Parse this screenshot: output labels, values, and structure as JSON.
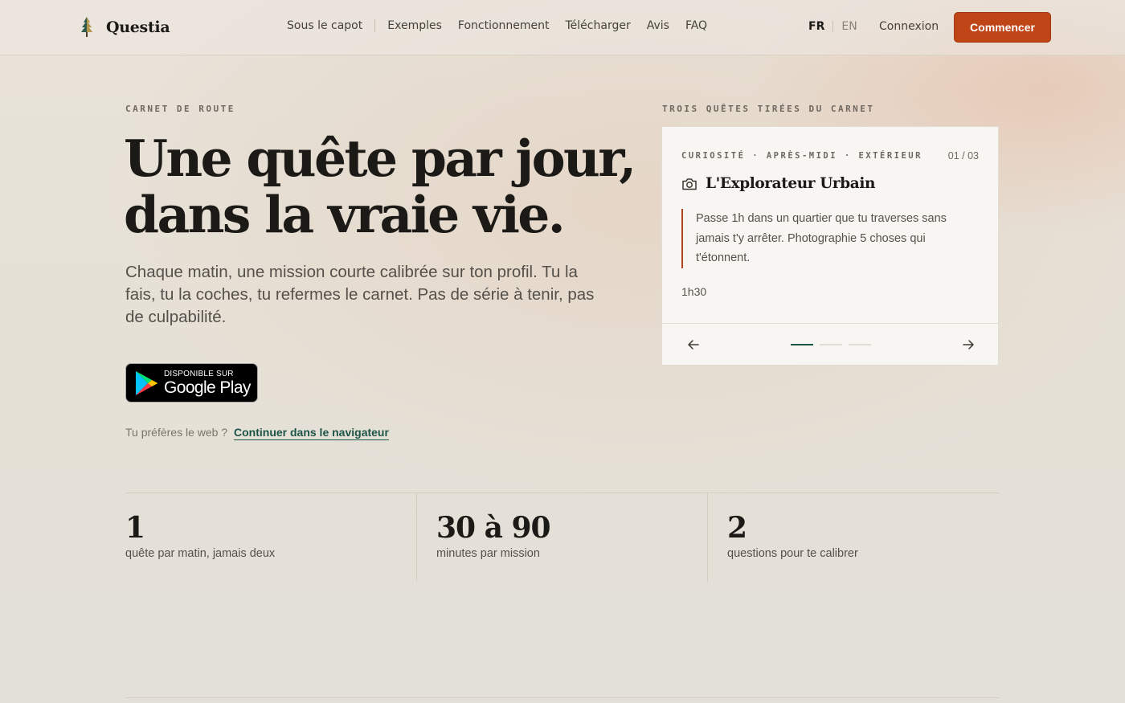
{
  "brand": {
    "name": "Questia",
    "logo_icon": "tree-icon",
    "accent": "#c04516",
    "green": "#1d5448"
  },
  "nav": {
    "items": [
      {
        "label": "Sous le capot"
      },
      {
        "label": "Exemples"
      },
      {
        "label": "Fonctionnement"
      },
      {
        "label": "Télécharger"
      },
      {
        "label": "Avis"
      },
      {
        "label": "FAQ"
      }
    ]
  },
  "lang": {
    "fr": "FR",
    "en": "EN"
  },
  "header": {
    "login": "Connexion",
    "cta": "Commencer"
  },
  "hero": {
    "eyebrow": "CARNET DE ROUTE",
    "headline_line1": "Une quête par jour,",
    "headline_line2": "dans la vraie vie.",
    "subtitle": "Chaque matin, une mission courte calibrée sur ton profil. Tu la fais, tu la coches, tu refermes le carnet. Pas de série à tenir, pas de culpabilité.",
    "store_badge_small": "DISPONIBLE SUR",
    "store_badge_big": "Google Play",
    "web_prompt": "Tu préfères le web ?",
    "web_link": "Continuer dans le navigateur"
  },
  "quests": {
    "eyebrow": "TROIS QUÊTES TIRÉES DU CARNET",
    "card": {
      "tags": "CURIOSITÉ · APRÈS-MIDI · EXTÉRIEUR",
      "counter": "01 / 03",
      "icon": "camera-icon",
      "title": "L'Explorateur Urbain",
      "description": "Passe 1h dans un quartier que tu traverses sans jamais t'y arrêter. Photographie 5 choses qui t'étonnent.",
      "duration": "1h30"
    },
    "active_index": 0,
    "total": 3
  },
  "stats": [
    {
      "value": "1",
      "label": "quête par matin, jamais deux"
    },
    {
      "value": "30 à 90",
      "label": "minutes par mission"
    },
    {
      "value": "2",
      "label": "questions pour te calibrer"
    }
  ]
}
